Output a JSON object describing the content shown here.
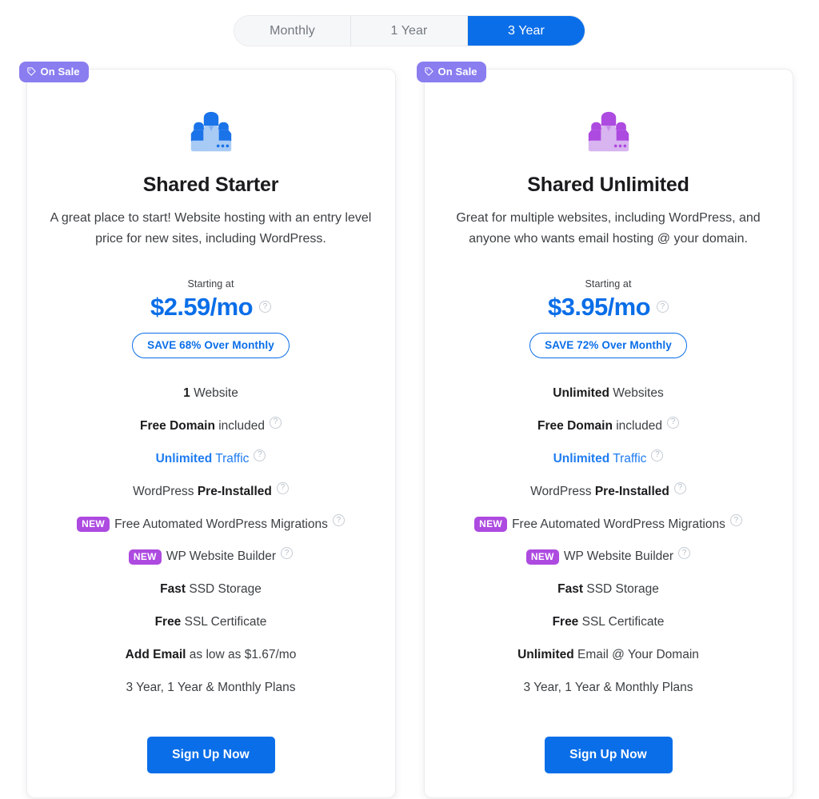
{
  "term_toggle": {
    "options": [
      {
        "label": "Monthly",
        "active": false
      },
      {
        "label": "1 Year",
        "active": false
      },
      {
        "label": "3 Year",
        "active": true
      }
    ]
  },
  "colors": {
    "brand_blue": "#0a6ee8",
    "accent_blue": "#1f7cf0",
    "sale_purple": "#8a7df0",
    "new_purple": "#ad4ae0",
    "icon_blue": "#3b86f0",
    "icon_purple": "#b06fe8"
  },
  "plans": [
    {
      "sale_badge": "On Sale",
      "sale_icon": "tag-icon",
      "icon": "people-group-icon",
      "icon_theme": "blue",
      "name": "Shared Starter",
      "description": "A great place to start! Website hosting with an entry level price for new sites, including WordPress.",
      "price_label": "Starting at",
      "price": "$2.59/mo",
      "price_help": "?",
      "save_label": "SAVE 68% Over Monthly",
      "features": [
        {
          "bold": "1",
          "text": " Website",
          "help": false,
          "new": false,
          "accent": false
        },
        {
          "bold": "Free Domain",
          "text": " included",
          "help": true,
          "new": false,
          "accent": false
        },
        {
          "bold": "Unlimited",
          "text": " Traffic",
          "help": true,
          "new": false,
          "accent": true
        },
        {
          "bold": "",
          "text": "WordPress ",
          "bold_after": "Pre-Installed",
          "help": true,
          "new": false,
          "accent": false
        },
        {
          "bold": "",
          "text": "Free Automated WordPress Migrations",
          "help": true,
          "new": true,
          "new_label": "NEW",
          "accent": false
        },
        {
          "bold": "",
          "text": "WP Website Builder",
          "help": true,
          "new": true,
          "new_label": "NEW",
          "accent": false
        },
        {
          "bold": "Fast",
          "text": " SSD Storage",
          "help": false,
          "new": false,
          "accent": false
        },
        {
          "bold": "Free",
          "text": " SSL Certificate",
          "help": false,
          "new": false,
          "accent": false
        },
        {
          "bold": "Add Email",
          "text": " as low as $1.67/mo",
          "help": false,
          "new": false,
          "accent": false
        },
        {
          "bold": "",
          "text": "3 Year, 1 Year & Monthly Plans",
          "help": false,
          "new": false,
          "accent": false
        }
      ],
      "cta": "Sign Up Now"
    },
    {
      "sale_badge": "On Sale",
      "sale_icon": "tag-icon",
      "icon": "people-group-icon",
      "icon_theme": "purple",
      "name": "Shared Unlimited",
      "description": "Great for multiple websites, including WordPress, and anyone who wants email hosting @ your domain.",
      "price_label": "Starting at",
      "price": "$3.95/mo",
      "price_help": "?",
      "save_label": "SAVE 72% Over Monthly",
      "features": [
        {
          "bold": "Unlimited",
          "text": " Websites",
          "help": false,
          "new": false,
          "accent": false
        },
        {
          "bold": "Free Domain",
          "text": " included",
          "help": true,
          "new": false,
          "accent": false
        },
        {
          "bold": "Unlimited",
          "text": " Traffic",
          "help": true,
          "new": false,
          "accent": true
        },
        {
          "bold": "",
          "text": "WordPress ",
          "bold_after": "Pre-Installed",
          "help": true,
          "new": false,
          "accent": false
        },
        {
          "bold": "",
          "text": "Free Automated WordPress Migrations",
          "help": true,
          "new": true,
          "new_label": "NEW",
          "accent": false
        },
        {
          "bold": "",
          "text": "WP Website Builder",
          "help": true,
          "new": true,
          "new_label": "NEW",
          "accent": false
        },
        {
          "bold": "Fast",
          "text": " SSD Storage",
          "help": false,
          "new": false,
          "accent": false
        },
        {
          "bold": "Free",
          "text": " SSL Certificate",
          "help": false,
          "new": false,
          "accent": false
        },
        {
          "bold": "Unlimited",
          "text": " Email @ Your Domain",
          "help": false,
          "new": false,
          "accent": false
        },
        {
          "bold": "",
          "text": "3 Year, 1 Year & Monthly Plans",
          "help": false,
          "new": false,
          "accent": false
        }
      ],
      "cta": "Sign Up Now"
    }
  ]
}
